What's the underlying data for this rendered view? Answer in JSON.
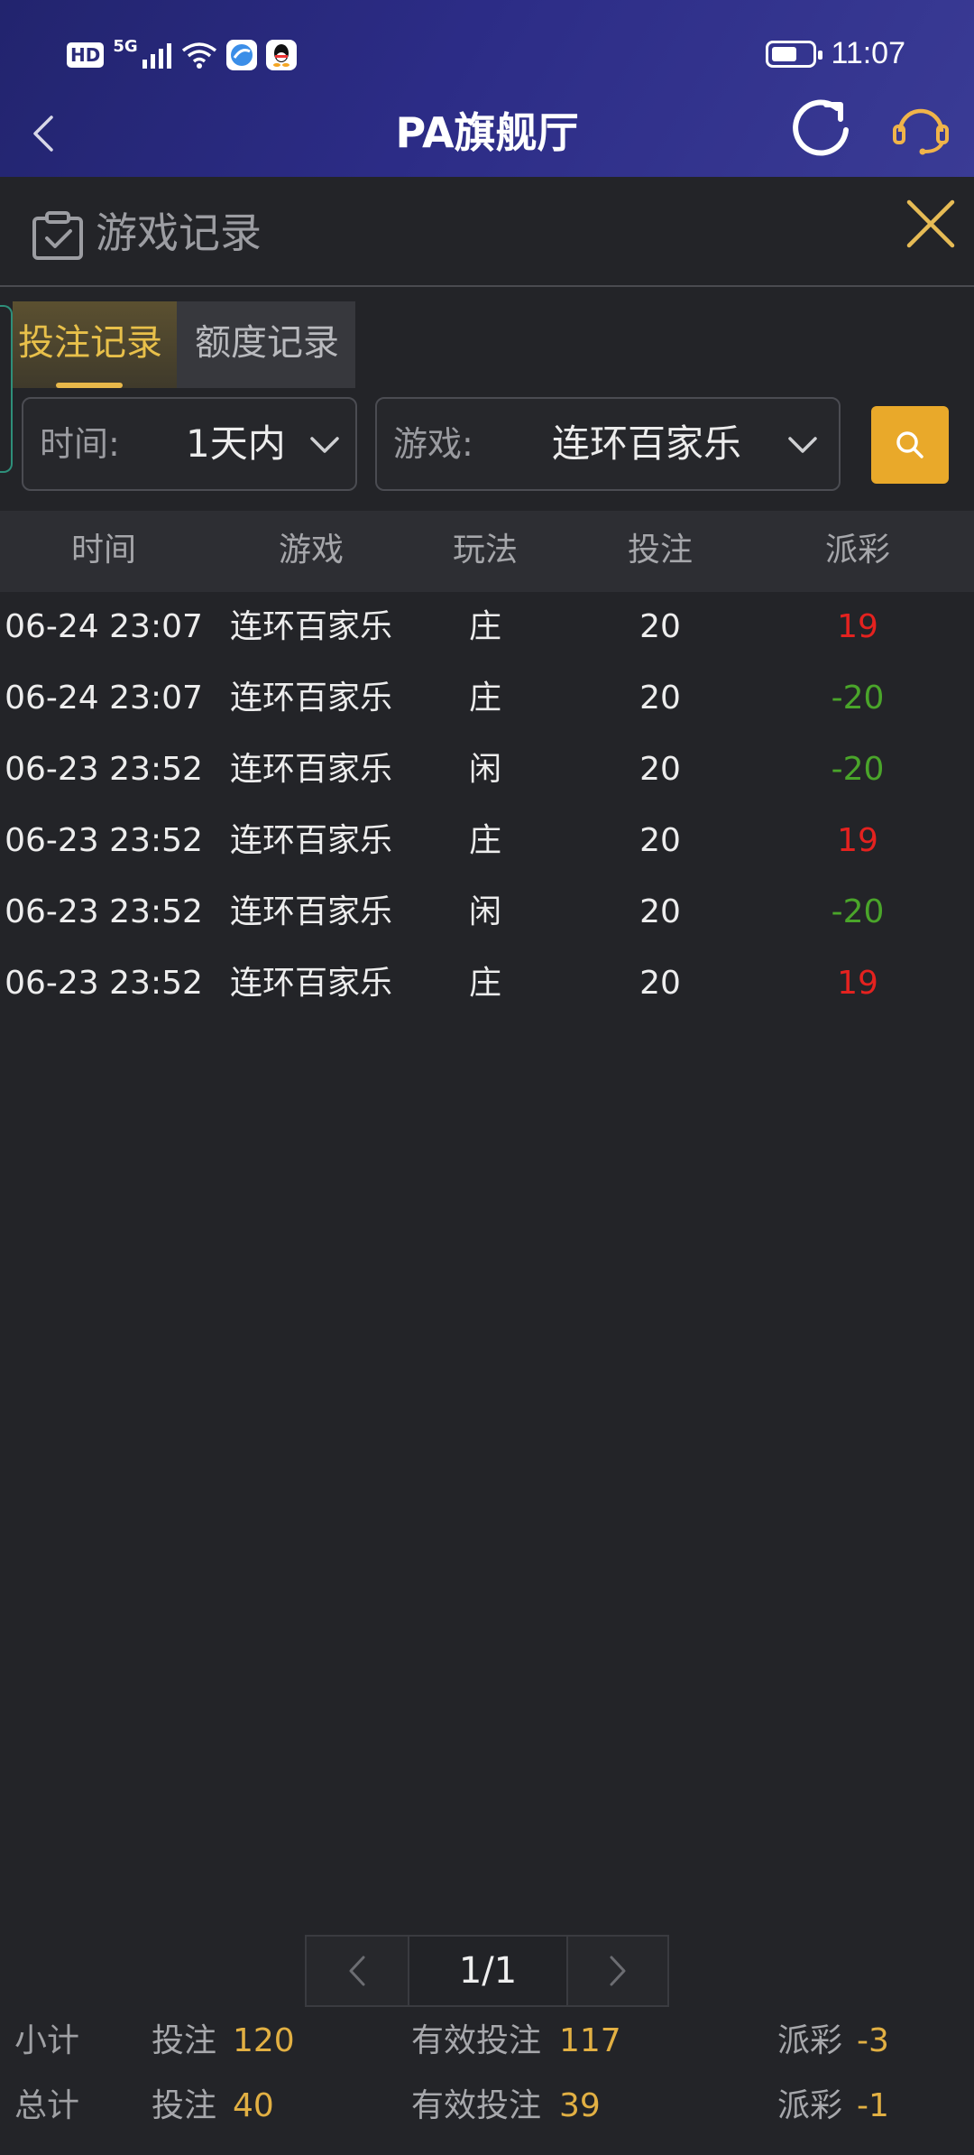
{
  "status_bar": {
    "hd": "HD",
    "network": "5G",
    "time": "11:07",
    "battery_level": 0.62
  },
  "nav": {
    "title": "PA旗舰厅"
  },
  "section": {
    "title": "游戏记录"
  },
  "tabs": [
    {
      "label": "投注记录",
      "active": true
    },
    {
      "label": "额度记录",
      "active": false
    }
  ],
  "filters": {
    "time_label": "时间:",
    "time_value": "1天内",
    "game_label": "游戏:",
    "game_value": "连环百家乐"
  },
  "table": {
    "columns": [
      "时间",
      "游戏",
      "玩法",
      "投注",
      "派彩"
    ],
    "rows": [
      {
        "time": "06-24 23:07",
        "game": "连环百家乐",
        "play": "庄",
        "bet": "20",
        "payout": "19"
      },
      {
        "time": "06-24 23:07",
        "game": "连环百家乐",
        "play": "庄",
        "bet": "20",
        "payout": "-20"
      },
      {
        "time": "06-23 23:52",
        "game": "连环百家乐",
        "play": "闲",
        "bet": "20",
        "payout": "-20"
      },
      {
        "time": "06-23 23:52",
        "game": "连环百家乐",
        "play": "庄",
        "bet": "20",
        "payout": "19"
      },
      {
        "time": "06-23 23:52",
        "game": "连环百家乐",
        "play": "闲",
        "bet": "20",
        "payout": "-20"
      },
      {
        "time": "06-23 23:52",
        "game": "连环百家乐",
        "play": "庄",
        "bet": "20",
        "payout": "19"
      }
    ]
  },
  "pagination": {
    "info": "1/1"
  },
  "totals": {
    "subtotal": {
      "label": "小计",
      "bet_label": "投注",
      "bet": "120",
      "valid_label": "有效投注",
      "valid": "117",
      "payout_label": "派彩",
      "payout": "-3"
    },
    "total": {
      "label": "总计",
      "bet_label": "投注",
      "bet": "40",
      "valid_label": "有效投注",
      "valid": "39",
      "payout_label": "派彩",
      "payout": "-1"
    }
  },
  "colors": {
    "header": "#2c2c86",
    "background": "#232428",
    "accent": "#e9a92a",
    "positive": "#e4221f",
    "negative": "#4aa52a"
  }
}
